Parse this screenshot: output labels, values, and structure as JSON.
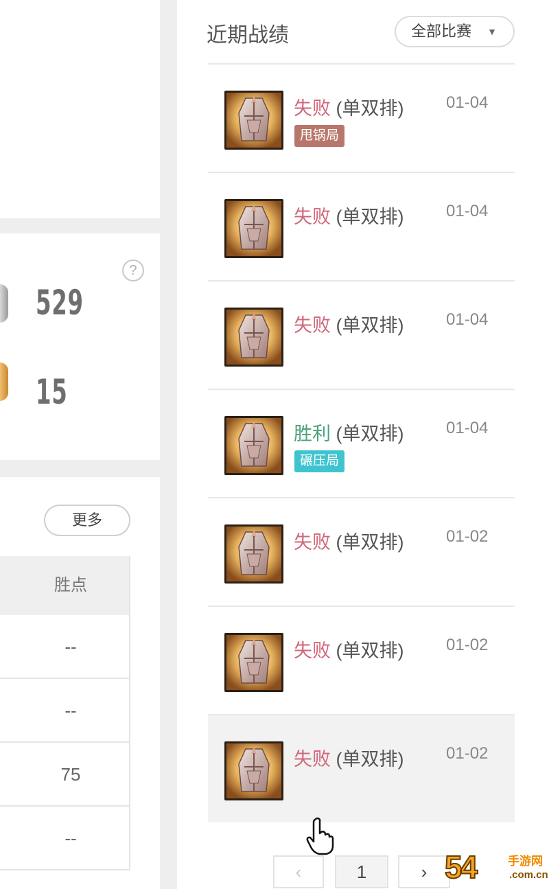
{
  "stats": {
    "help_symbol": "?",
    "value_1": "529",
    "value_2": "15"
  },
  "rank_table": {
    "more_label": "更多",
    "column_header": "胜点",
    "cells": [
      "--",
      "--",
      "75",
      "--"
    ]
  },
  "recent_matches": {
    "title": "近期战绩",
    "filter_label": "全部比赛",
    "filter_icon": "chevron-down-icon",
    "rows": [
      {
        "result": "失败",
        "mode": "(单双排)",
        "date": "01-04",
        "tag": "甩锅局",
        "outcome": "loss",
        "tag_color": "#b8776a"
      },
      {
        "result": "失败",
        "mode": "(单双排)",
        "date": "01-04",
        "tag": "",
        "outcome": "loss"
      },
      {
        "result": "失败",
        "mode": "(单双排)",
        "date": "01-04",
        "tag": "",
        "outcome": "loss"
      },
      {
        "result": "胜利",
        "mode": "(单双排)",
        "date": "01-04",
        "tag": "碾压局",
        "outcome": "win",
        "tag_color": "#3fc4cf"
      },
      {
        "result": "失败",
        "mode": "(单双排)",
        "date": "01-02",
        "tag": "",
        "outcome": "loss"
      },
      {
        "result": "失败",
        "mode": "(单双排)",
        "date": "01-02",
        "tag": "",
        "outcome": "loss"
      },
      {
        "result": "失败",
        "mode": "(单双排)",
        "date": "01-02",
        "tag": "",
        "outcome": "loss"
      }
    ]
  },
  "pagination": {
    "prev": "‹",
    "current": "1",
    "next": "›"
  },
  "watermark": {
    "number": "54",
    "cn": "手游网",
    "url": ".com.cn"
  },
  "colors": {
    "loss": "#d1667a",
    "win": "#4aa27a"
  }
}
